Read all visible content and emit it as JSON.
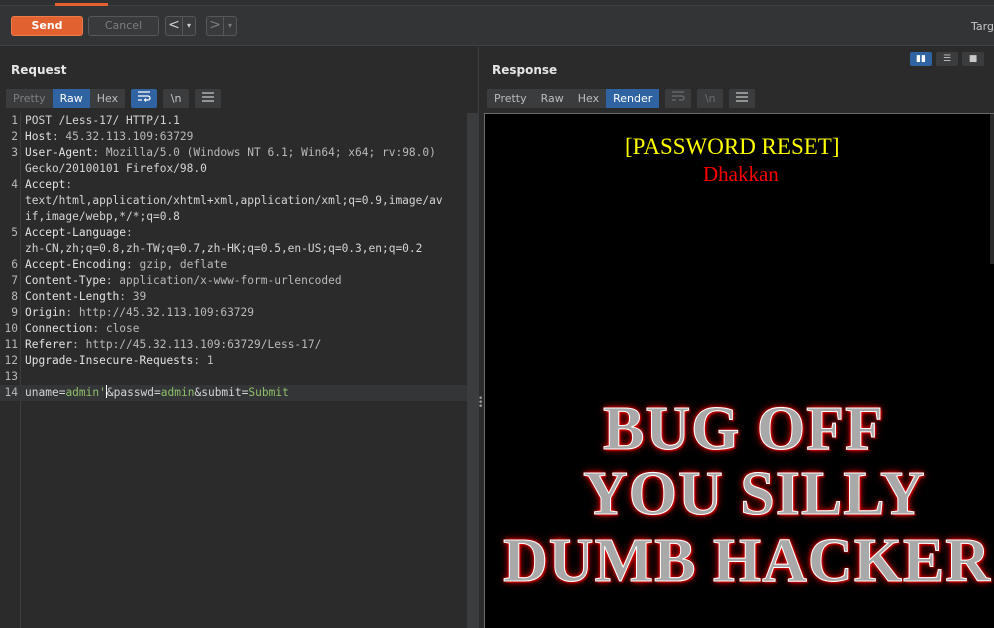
{
  "toolbar": {
    "send_label": "Send",
    "cancel_label": "Cancel",
    "back_arrow": "<",
    "forward_arrow": ">",
    "dropdown_glyph": "▾",
    "target_label": "Targ"
  },
  "request": {
    "title": "Request",
    "tabs": [
      {
        "label": "Pretty",
        "state": "dim"
      },
      {
        "label": "Raw",
        "state": "active"
      },
      {
        "label": "Hex",
        "state": "normal"
      }
    ],
    "icons": {
      "wrap": "wrap-lines-icon",
      "newline": "\\n",
      "menu": "menu-icon"
    },
    "lines": [
      {
        "n": "1",
        "text": "POST /Less-17/ HTTP/1.1"
      },
      {
        "n": "2",
        "name": "Host",
        "value": ": 45.32.113.109:63729"
      },
      {
        "n": "3",
        "name": "User-Agent",
        "value": ": Mozilla/5.0 (Windows NT 6.1; Win64; x64; rv:98.0)"
      },
      {
        "n": "",
        "text": "Gecko/20100101 Firefox/98.0"
      },
      {
        "n": "4",
        "name": "Accept",
        "value": ":"
      },
      {
        "n": "",
        "text": "text/html,application/xhtml+xml,application/xml;q=0.9,image/av"
      },
      {
        "n": "",
        "text": "if,image/webp,*/*;q=0.8"
      },
      {
        "n": "5",
        "name": "Accept-Language",
        "value": ":"
      },
      {
        "n": "",
        "text": "zh-CN,zh;q=0.8,zh-TW;q=0.7,zh-HK;q=0.5,en-US;q=0.3,en;q=0.2"
      },
      {
        "n": "6",
        "name": "Accept-Encoding",
        "value": ": gzip, deflate"
      },
      {
        "n": "7",
        "name": "Content-Type",
        "value": ": application/x-www-form-urlencoded"
      },
      {
        "n": "8",
        "name": "Content-Length",
        "value": ": 39"
      },
      {
        "n": "9",
        "name": "Origin",
        "value": ": http://45.32.113.109:63729"
      },
      {
        "n": "10",
        "name": "Connection",
        "value": ": close"
      },
      {
        "n": "11",
        "name": "Referer",
        "value": ": http://45.32.113.109:63729/Less-17/"
      },
      {
        "n": "12",
        "name": "Upgrade-Insecure-Requests",
        "value": ": 1"
      },
      {
        "n": "13",
        "text": ""
      }
    ],
    "body_line": {
      "n": "14",
      "p1": "uname",
      "eq1": "=",
      "v1": "admin'",
      "amp1": "&",
      "p2": "passwd",
      "eq2": "=",
      "v2": "admin",
      "amp2": "&",
      "p3": "submit",
      "eq3": "=",
      "v3": "Submit"
    }
  },
  "response": {
    "title": "Response",
    "tabs": [
      {
        "label": "Pretty",
        "state": "normal"
      },
      {
        "label": "Raw",
        "state": "normal"
      },
      {
        "label": "Hex",
        "state": "normal"
      },
      {
        "label": "Render",
        "state": "active"
      }
    ],
    "render": {
      "heading": "[PASSWORD RESET]",
      "subheading": "Dhakkan",
      "banner_lines": [
        "BUG OFF",
        "YOU SILLY",
        "DUMB HACKER"
      ]
    }
  },
  "colors": {
    "send": "#e16230",
    "active_tab": "#2f63a1",
    "heading": "#ffff00",
    "subheading": "#ff0000",
    "param_value": "#8fbf6a"
  }
}
